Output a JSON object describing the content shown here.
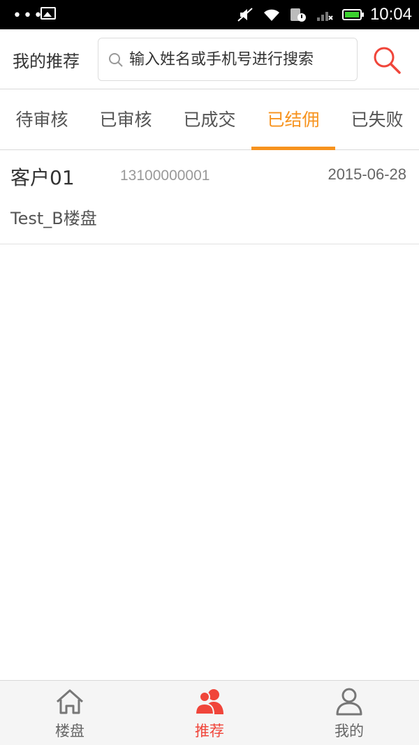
{
  "status_bar": {
    "time": "10:04"
  },
  "header": {
    "title": "我的推荐",
    "search_placeholder": "输入姓名或手机号进行搜索"
  },
  "tabs": [
    {
      "label": "待审核",
      "active": false
    },
    {
      "label": "已审核",
      "active": false
    },
    {
      "label": "已成交",
      "active": false
    },
    {
      "label": "已结佣",
      "active": true
    },
    {
      "label": "已失败",
      "active": false
    }
  ],
  "list": [
    {
      "name": "客户01",
      "phone": "13100000001",
      "date": "2015-06-28",
      "project": "Test_B楼盘"
    }
  ],
  "bottom_nav": [
    {
      "label": "楼盘",
      "icon": "home-icon",
      "active": false
    },
    {
      "label": "推荐",
      "icon": "users-icon",
      "active": true
    },
    {
      "label": "我的",
      "icon": "user-icon",
      "active": false
    }
  ],
  "colors": {
    "accent": "#f7931e",
    "nav_active": "#f0453a",
    "search_icon": "#f0453a"
  }
}
